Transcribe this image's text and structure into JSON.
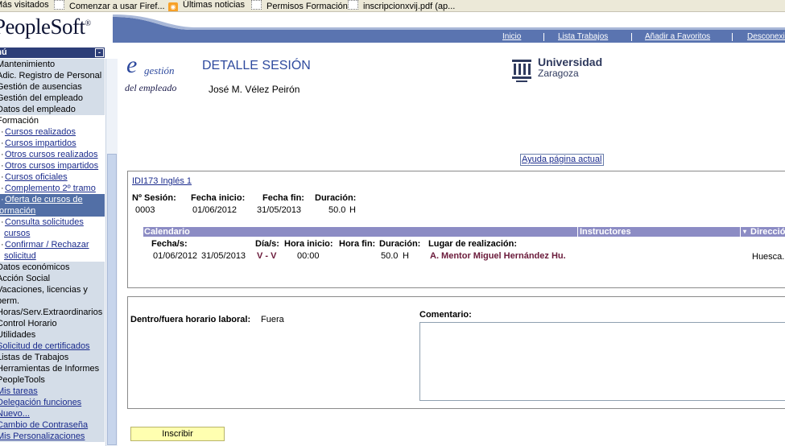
{
  "bookmarks": [
    "Más visitados",
    "Comenzar a usar Firef...",
    "Últimas noticias",
    "Permisos Formación",
    "inscripcionxvij.pdf (ap..."
  ],
  "app": {
    "logo": "PeopleSoft",
    "logo_mark": "®"
  },
  "toplinks": [
    "Inicio",
    "Lista Trabajos",
    "Añadir a Favoritos",
    "Desconexión"
  ],
  "sidebar": {
    "title": "Menú",
    "collapse_glyph": "-",
    "items": [
      {
        "label": "Mantenimiento",
        "style": "gray",
        "link": false
      },
      {
        "label": "Adic. Registro de Personal",
        "style": "gray",
        "link": false
      },
      {
        "label": "Gestión de ausencias",
        "style": "gray",
        "link": false
      },
      {
        "label": "Gestión del empleado",
        "style": "gray",
        "link": false
      },
      {
        "label": "Datos del empleado",
        "style": "gray",
        "link": false
      },
      {
        "label": "Formación",
        "style": "white",
        "link": false
      },
      {
        "label": "Cursos realizados",
        "style": "white",
        "link": true,
        "bullet": true
      },
      {
        "label": "Cursos impartidos",
        "style": "white",
        "link": true,
        "bullet": true
      },
      {
        "label": "Otros cursos realizados",
        "style": "white",
        "link": true,
        "bullet": true
      },
      {
        "label": "Otros cursos impartidos",
        "style": "white",
        "link": true,
        "bullet": true
      },
      {
        "label": "Cursos oficiales",
        "style": "white",
        "link": true,
        "bullet": true
      },
      {
        "label": "Complemento 2º tramo",
        "style": "white",
        "link": true,
        "bullet": true
      },
      {
        "label": "Oferta de cursos de",
        "style": "sel",
        "link": true,
        "bullet": true
      },
      {
        "label": "formación",
        "style": "sel",
        "link": true,
        "bullet": false
      },
      {
        "label": "Consulta solicitudes",
        "style": "white",
        "link": true,
        "bullet": true
      },
      {
        "label": "cursos",
        "style": "white",
        "link": true,
        "bullet": false
      },
      {
        "label": "Confirmar / Rechazar",
        "style": "white",
        "link": true,
        "bullet": true
      },
      {
        "label": "solicitud",
        "style": "white",
        "link": true,
        "bullet": false
      },
      {
        "label": "Datos económicos",
        "style": "gray",
        "link": false
      },
      {
        "label": "Acción Social",
        "style": "gray",
        "link": false
      },
      {
        "label": "Vacaciones, licencias y",
        "style": "gray",
        "link": false
      },
      {
        "label": "perm.",
        "style": "gray",
        "link": false
      },
      {
        "label": "Horas/Serv.Extraordinarios",
        "style": "gray",
        "link": false
      },
      {
        "label": "Control Horario",
        "style": "gray",
        "link": false
      },
      {
        "label": "Utilidades",
        "style": "gray",
        "link": false
      },
      {
        "label": "Solicitud de certificados",
        "style": "gray",
        "link": true
      },
      {
        "label": "Listas de Trabajos",
        "style": "gray",
        "link": false
      },
      {
        "label": "Herramientas de Informes",
        "style": "gray",
        "link": false
      },
      {
        "label": "PeopleTools",
        "style": "gray",
        "link": false
      },
      {
        "label": "Mis tareas",
        "style": "gray",
        "link": true
      },
      {
        "label": "Delegación funciones",
        "style": "gray",
        "link": true
      },
      {
        "label": "Nuevo...",
        "style": "gray",
        "link": true
      },
      {
        "label": "Cambio de Contraseña",
        "style": "gray",
        "link": true
      },
      {
        "label": "Mis Personalizaciones",
        "style": "gray",
        "link": true
      }
    ]
  },
  "brand": {
    "e": "e",
    "gestion": "gestión",
    "del_empleado": "del empleado"
  },
  "page": {
    "title": "DETALLE SESIÓN",
    "person": "José M. Vélez Peirón"
  },
  "university": {
    "line1": "Universidad",
    "line2": "Zaragoza"
  },
  "help_link": "Ayuda página actual",
  "session": {
    "course_link": "IDI173 Inglés 1",
    "headers": {
      "num": "Nº Sesión:",
      "start": "Fecha inicio:",
      "end": "Fecha fin:",
      "dur": "Duración:"
    },
    "values": {
      "num": "0003",
      "start": "01/06/2012",
      "end": "31/05/2013",
      "dur": "50.0",
      "unit": "H"
    }
  },
  "calendar": {
    "bar": {
      "calendar": "Calendario",
      "instructors": "Instructores",
      "direction": "Dirección"
    },
    "cols": {
      "dates": "Fecha/s:",
      "days": "Día/s:",
      "hstart": "Hora inicio:",
      "hend": "Hora fin:",
      "dur": "Duración:",
      "place": "Lugar de realización:"
    },
    "row": {
      "date1": "01/06/2012",
      "date2": "31/05/2013",
      "days": "V - V",
      "hstart": "00:00",
      "dur": "50.0",
      "unit": "H",
      "place": "A. Mentor Miguel Hernández Hu.",
      "direction": "Huesca."
    }
  },
  "work_hours": {
    "label": "Dentro/fuera horario laboral:",
    "value": "Fuera"
  },
  "comment": {
    "label": "Comentario:",
    "value": ""
  },
  "enroll_button": "Inscribir",
  "colors": {
    "nav_band": "#5a74b0",
    "sidebar_head": "#2d3e78",
    "sidebar_gray": "#d4dde8",
    "selected": "#526fa6",
    "calendar_bar": "#8c8cc4",
    "title": "#2e4a9e",
    "button": "#ffffb0",
    "place": "#6a1a3a"
  }
}
